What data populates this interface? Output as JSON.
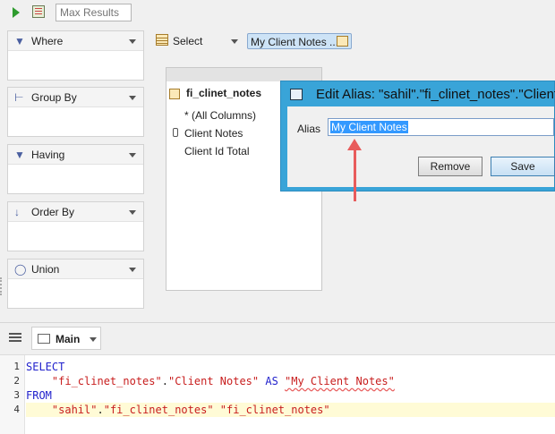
{
  "toolbar": {
    "max_results_placeholder": "Max Results"
  },
  "panels": [
    {
      "id": "where",
      "label": "Where",
      "icon": "funnel-icon"
    },
    {
      "id": "group-by",
      "label": "Group By",
      "icon": "group-by-icon"
    },
    {
      "id": "having",
      "label": "Having",
      "icon": "having-icon"
    },
    {
      "id": "order-by",
      "label": "Order By",
      "icon": "sort-az-icon"
    },
    {
      "id": "union",
      "label": "Union",
      "icon": "union-icon"
    }
  ],
  "select_bar": {
    "select_label": "Select",
    "alias_chip": "My Client Notes ..."
  },
  "table": {
    "name": "fi_clinet_notes",
    "columns": [
      "* (All Columns)",
      "Client Notes",
      "Client Id Total"
    ]
  },
  "dialog": {
    "title": "Edit Alias: \"sahil\".\"fi_clinet_notes\".\"Client",
    "alias_label": "Alias",
    "alias_value": "My Client Notes",
    "remove_label": "Remove",
    "save_label": "Save"
  },
  "tabs": {
    "main_label": "Main"
  },
  "sql": {
    "line_numbers": [
      "1",
      "2",
      "3",
      "4"
    ],
    "select_kw": "SELECT",
    "l2_indent": "    ",
    "l2_table": "\"fi_clinet_notes\"",
    "l2_dot": ".",
    "l2_col": "\"Client Notes\"",
    "l2_as": " AS ",
    "l2_alias": "\"My Client Notes\"",
    "from_kw": "FROM",
    "l4_indent": "    ",
    "l4_schema": "\"sahil\"",
    "l4_dot": ".",
    "l4_table": "\"fi_clinet_notes\"",
    "l4_space": " ",
    "l4_alias": "\"fi_clinet_notes\""
  },
  "colors": {
    "dialog_border": "#39a4d8",
    "selection": "#3399ff",
    "arrow": "#e85c5c",
    "keyword": "#2222cc",
    "string": "#c81e1e"
  }
}
